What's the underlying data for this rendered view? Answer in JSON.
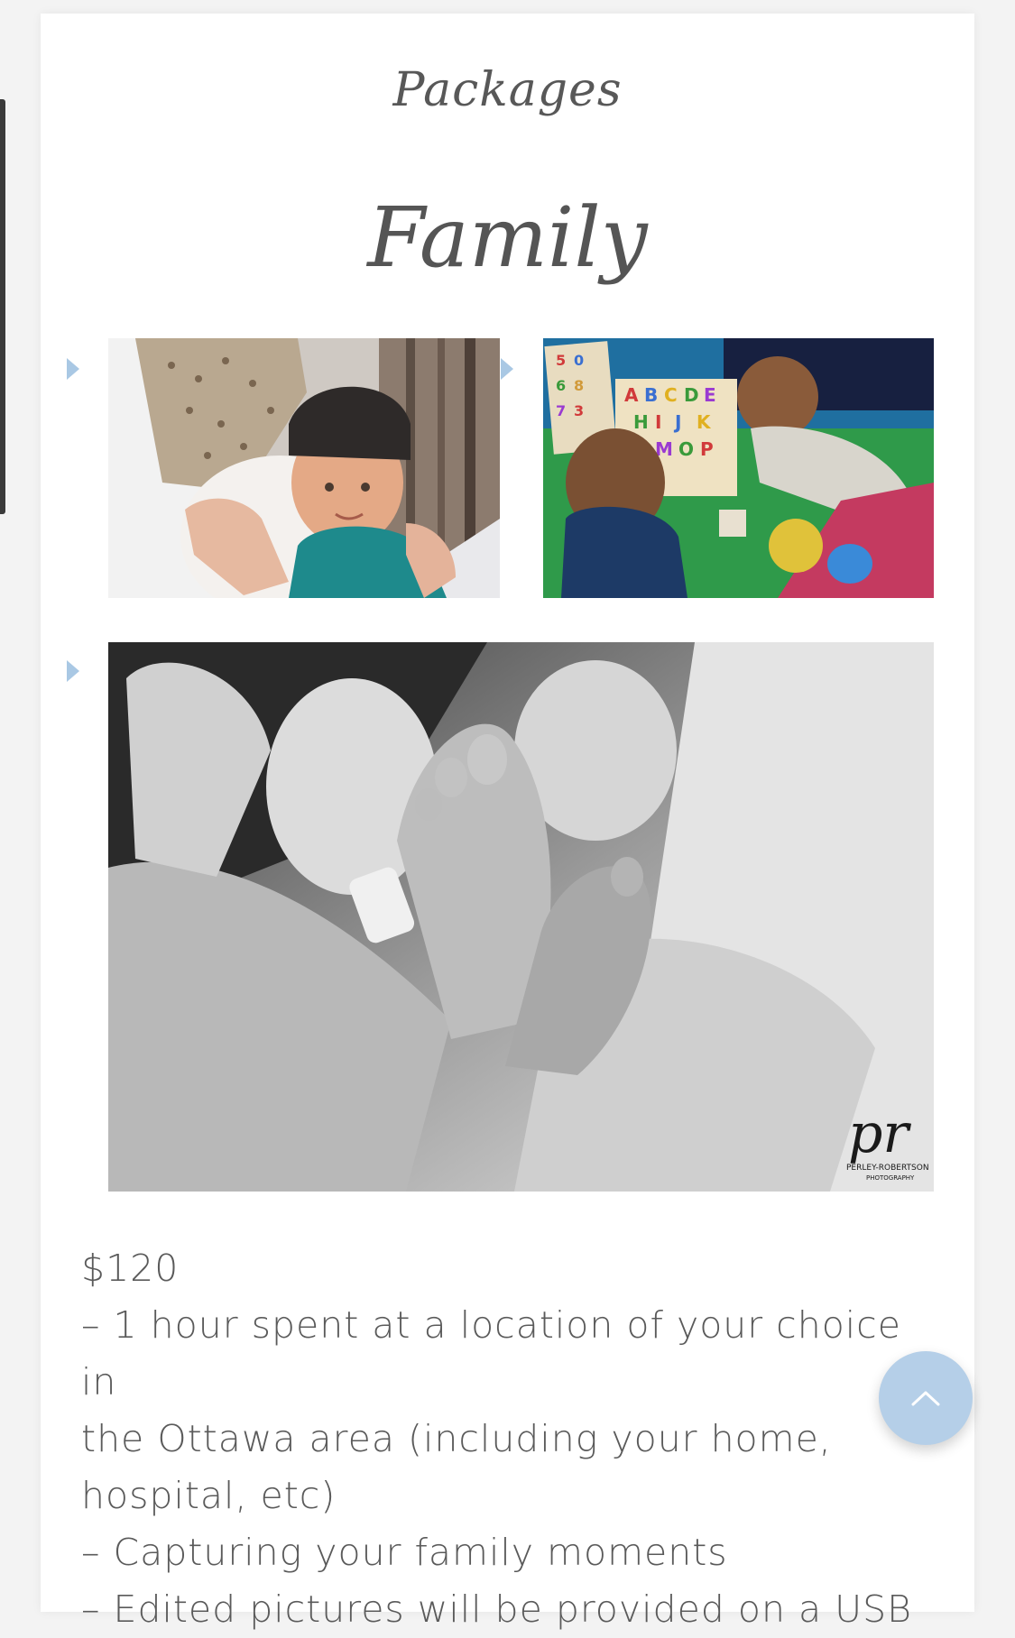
{
  "page": {
    "section_title": "Packages",
    "package_title": "Family"
  },
  "gallery": {
    "images": [
      {
        "name": "mother-and-child-photo",
        "alt": ""
      },
      {
        "name": "children-puzzle-photo",
        "alt": ""
      },
      {
        "name": "newborn-feet-photo",
        "alt": ""
      }
    ],
    "watermark_lines": [
      "pr",
      "PERLEY-ROBERTSON",
      "PHOTOGRAPHY"
    ]
  },
  "package": {
    "price": "$120",
    "lines": [
      "– 1 hour spent at a location of your choice in",
      "the Ottawa area (including your home,",
      "hospital, etc)",
      "– Capturing your family moments",
      "– Edited pictures will be provided on a USB"
    ]
  },
  "controls": {
    "scroll_top_icon": "chevron-up-icon"
  },
  "colors": {
    "accent": "#a9c8e4",
    "scroll_button": "#b5cfe8",
    "text": "#5a5a5a"
  }
}
